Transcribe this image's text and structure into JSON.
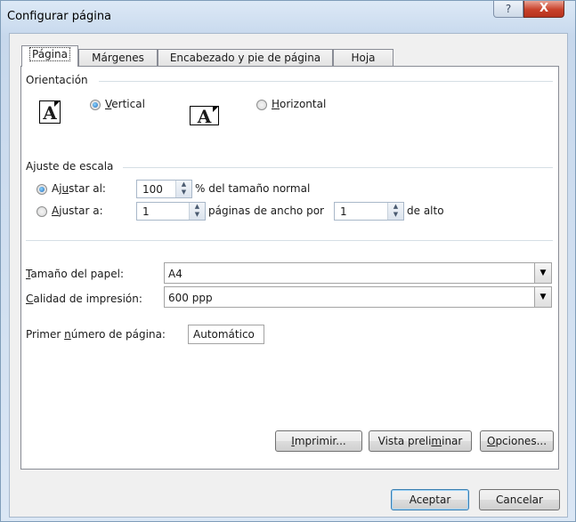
{
  "window": {
    "title": "Configurar página",
    "help_glyph": "?",
    "close_glyph": "X"
  },
  "tabs": [
    {
      "label": "Página",
      "active": true
    },
    {
      "label": "Márgenes",
      "active": false
    },
    {
      "label": "Encabezado y pie de página",
      "active": false
    },
    {
      "label": "Hoja",
      "active": false
    }
  ],
  "orientation": {
    "group_label": "Orientación",
    "icon_letter": "A",
    "portrait": {
      "label_pre": "",
      "accel": "V",
      "label_post": "ertical",
      "checked": true
    },
    "landscape": {
      "label_pre": "",
      "accel": "H",
      "label_post": "orizontal",
      "checked": false
    }
  },
  "scaling": {
    "group_label": "Ajuste de escala",
    "adjust_pct": {
      "label_pre": "Aj",
      "accel": "u",
      "label_post": "star al:",
      "value": "100",
      "suffix": "% del tamaño normal",
      "checked": true
    },
    "fit_to": {
      "label_pre": "",
      "accel": "A",
      "label_post": "justar a:",
      "pages_wide": "1",
      "middle_text": "páginas de ancho por",
      "pages_tall": "1",
      "suffix": "de alto",
      "checked": false
    }
  },
  "paper_size": {
    "label_pre": "",
    "accel": "T",
    "label_post": "amaño del papel:",
    "value": "A4"
  },
  "print_quality": {
    "label_pre": "",
    "accel": "C",
    "label_post": "alidad de impresión:",
    "value": "600 ppp"
  },
  "first_page": {
    "label_pre": "Primer ",
    "accel": "n",
    "label_post": "úmero de página:",
    "value": "Automático"
  },
  "buttons": {
    "print": {
      "pre": "",
      "accel": "I",
      "post": "mprimir..."
    },
    "preview": {
      "pre": "Vista preli",
      "accel": "m",
      "post": "inar"
    },
    "options": {
      "pre": "",
      "accel": "O",
      "post": "pciones..."
    },
    "ok": "Aceptar",
    "cancel": "Cancelar"
  }
}
